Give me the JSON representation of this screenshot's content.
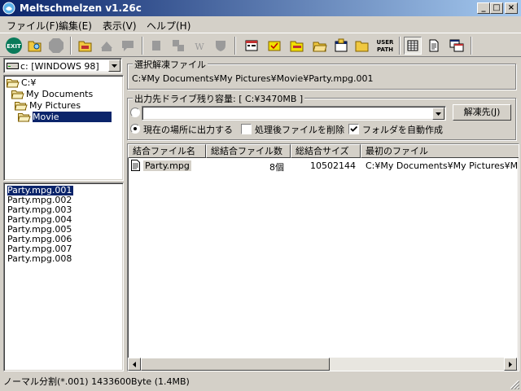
{
  "window": {
    "title": "Meltschmelzen v1.26c",
    "buttons": {
      "minimize": "_",
      "maximize": "□",
      "close": "×"
    }
  },
  "menu": [
    "ファイル(F)",
    "編集(E)",
    "表示(V)",
    "ヘルプ(H)"
  ],
  "toolbar": {
    "exit_label": "EXIT",
    "user_path_line1": "USER",
    "user_path_line2": "PATH",
    "w_label": "W"
  },
  "drive": {
    "value": "c: [WINDOWS 98]"
  },
  "tree": [
    "C:¥",
    "My Documents",
    "My Pictures",
    "Movie"
  ],
  "file_list": [
    "Party.mpg.001",
    "Party.mpg.002",
    "Party.mpg.003",
    "Party.mpg.004",
    "Party.mpg.005",
    "Party.mpg.006",
    "Party.mpg.007",
    "Party.mpg.008"
  ],
  "selected_file": {
    "group_title": "選択解凍ファイル",
    "path": "C:¥My Documents¥My Pictures¥Movie¥Party.mpg.001"
  },
  "output": {
    "group_title": "出力先ドライブ残り容量: [ C:¥3470MB ]",
    "combo_value": "",
    "extract_button": "解凍先(J)",
    "option_current_location": "現在の場所に出力する",
    "option_delete_after": "処理後ファイルを削除",
    "option_auto_folder": "フォルダを自動作成",
    "option_current_location_checked": true,
    "option_delete_after_checked": false,
    "option_auto_folder_checked": true
  },
  "table": {
    "columns": [
      "結合ファイル名",
      "総結合ファイル数",
      "総結合サイズ",
      "最初のファイル"
    ],
    "rows": [
      {
        "name": "Party.mpg",
        "count": "8個",
        "size": "10502144",
        "first": "C:¥My Documents¥My Pictures¥M"
      }
    ]
  },
  "status": "ノーマル分割(*.001) 1433600Byte (1.4MB)",
  "colors": {
    "titlebar": "#0a246a",
    "selection": "#0a246a",
    "face": "#d4d0c8"
  }
}
